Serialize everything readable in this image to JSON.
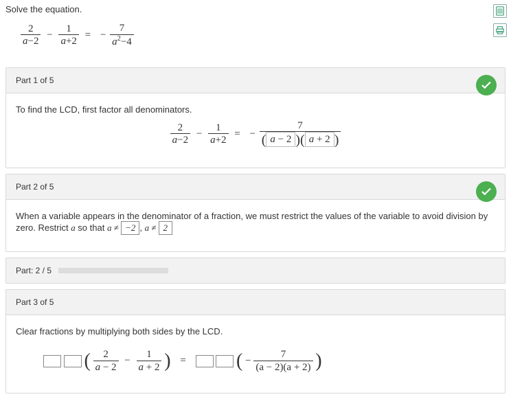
{
  "title": "Solve the equation.",
  "main_eq": {
    "f1_num": "2",
    "f1_den_pre": "a",
    "f1_den_op": "−2",
    "f2_num": "1",
    "f2_den_pre": "a",
    "f2_den_op": "+2",
    "rhs_neg": "−",
    "f3_num": "7",
    "f3_den": "a",
    "f3_den_sup": "2",
    "f3_den_op": "−4"
  },
  "part1": {
    "header": "Part 1 of 5",
    "text": "To find the LCD, first factor all denominators.",
    "eq": {
      "f1_num": "2",
      "f1_den": "a−2",
      "f2_num": "1",
      "f2_den": "a+2",
      "rhs_num": "7",
      "box1_a": "a",
      "box1_op": "− 2",
      "box2_a": "a",
      "box2_op": "+ 2"
    }
  },
  "part2": {
    "header": "Part 2 of 5",
    "text_pre": "When a variable appears in the denominator of a fraction, we must restrict the values of the variable to avoid division by zero. Restrict ",
    "var": "a",
    "text_mid": " so that ",
    "expr": "a ≠ ",
    "ans1": "−2",
    "sep": ", ",
    "expr2": "a ≠ ",
    "ans2": "2"
  },
  "progress": {
    "label": "Part: 2 / 5",
    "percent": 40
  },
  "part3": {
    "header": "Part 3 of 5",
    "text": "Clear fractions by multiplying both sides by the LCD.",
    "eq": {
      "f1_num": "2",
      "f1_den": "a − 2",
      "f2_num": "1",
      "f2_den": "a + 2",
      "rhs_num": "7",
      "rhs_den": "(a − 2)(a + 2)"
    }
  }
}
